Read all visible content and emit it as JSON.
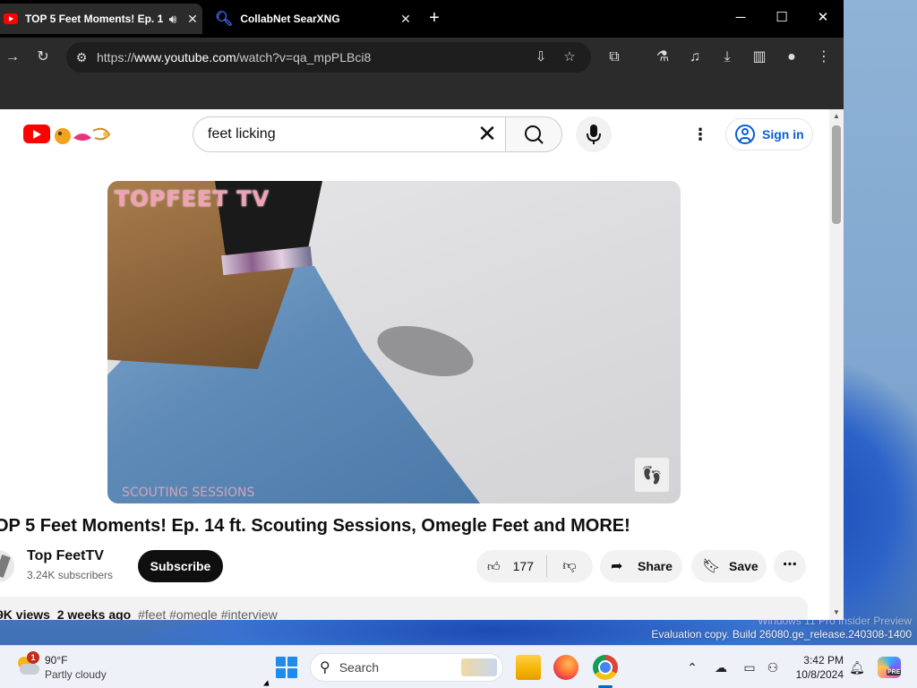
{
  "tabs": [
    {
      "title": "TOP 5 Feet Moments! Ep. 1",
      "audio_icon": "speaker-icon",
      "active": true
    },
    {
      "title": "CollabNet SearXNG",
      "active": false
    }
  ],
  "window_controls": {
    "minimize": "─",
    "maximize": "☐",
    "close": "✕"
  },
  "toolbar": {
    "url_scheme": "https://",
    "url_host": "www.youtube.com",
    "url_path": "/watch?v=qa_mpPLBci8"
  },
  "youtube": {
    "search_query": "feet licking",
    "sign_in_label": "Sign in",
    "video_overlay_title": "TOPFEET TV",
    "video_overlay_footer": "SCOUTING SESSIONS",
    "video_title": "OP 5 Feet Moments! Ep. 14 ft. Scouting Sessions, Omegle Feet and MORE!",
    "channel_name": "Top FeetTV",
    "subscribers": "3.24K subscribers",
    "subscribe_label": "Subscribe",
    "like_count": "177",
    "share_label": "Share",
    "save_label": "Save",
    "views": "9K views",
    "age": "2 weeks ago",
    "hashtags": "#feet #omegle #interview"
  },
  "desktop": {
    "watermark_line1": "Windows 11 Pro Insider Preview",
    "watermark_line2": "Evaluation copy. Build 26080.ge_release.240308-1400"
  },
  "taskbar": {
    "weather_badge": "1",
    "temperature": "90°F",
    "condition": "Partly cloudy",
    "search_placeholder": "Search",
    "time": "3:42 PM",
    "date": "10/8/2024",
    "copilot_badge": "PRE"
  },
  "colors": {
    "youtube_red": "#ff0000",
    "link_blue": "#065fd4",
    "start_blue": "#1f8ceb"
  }
}
